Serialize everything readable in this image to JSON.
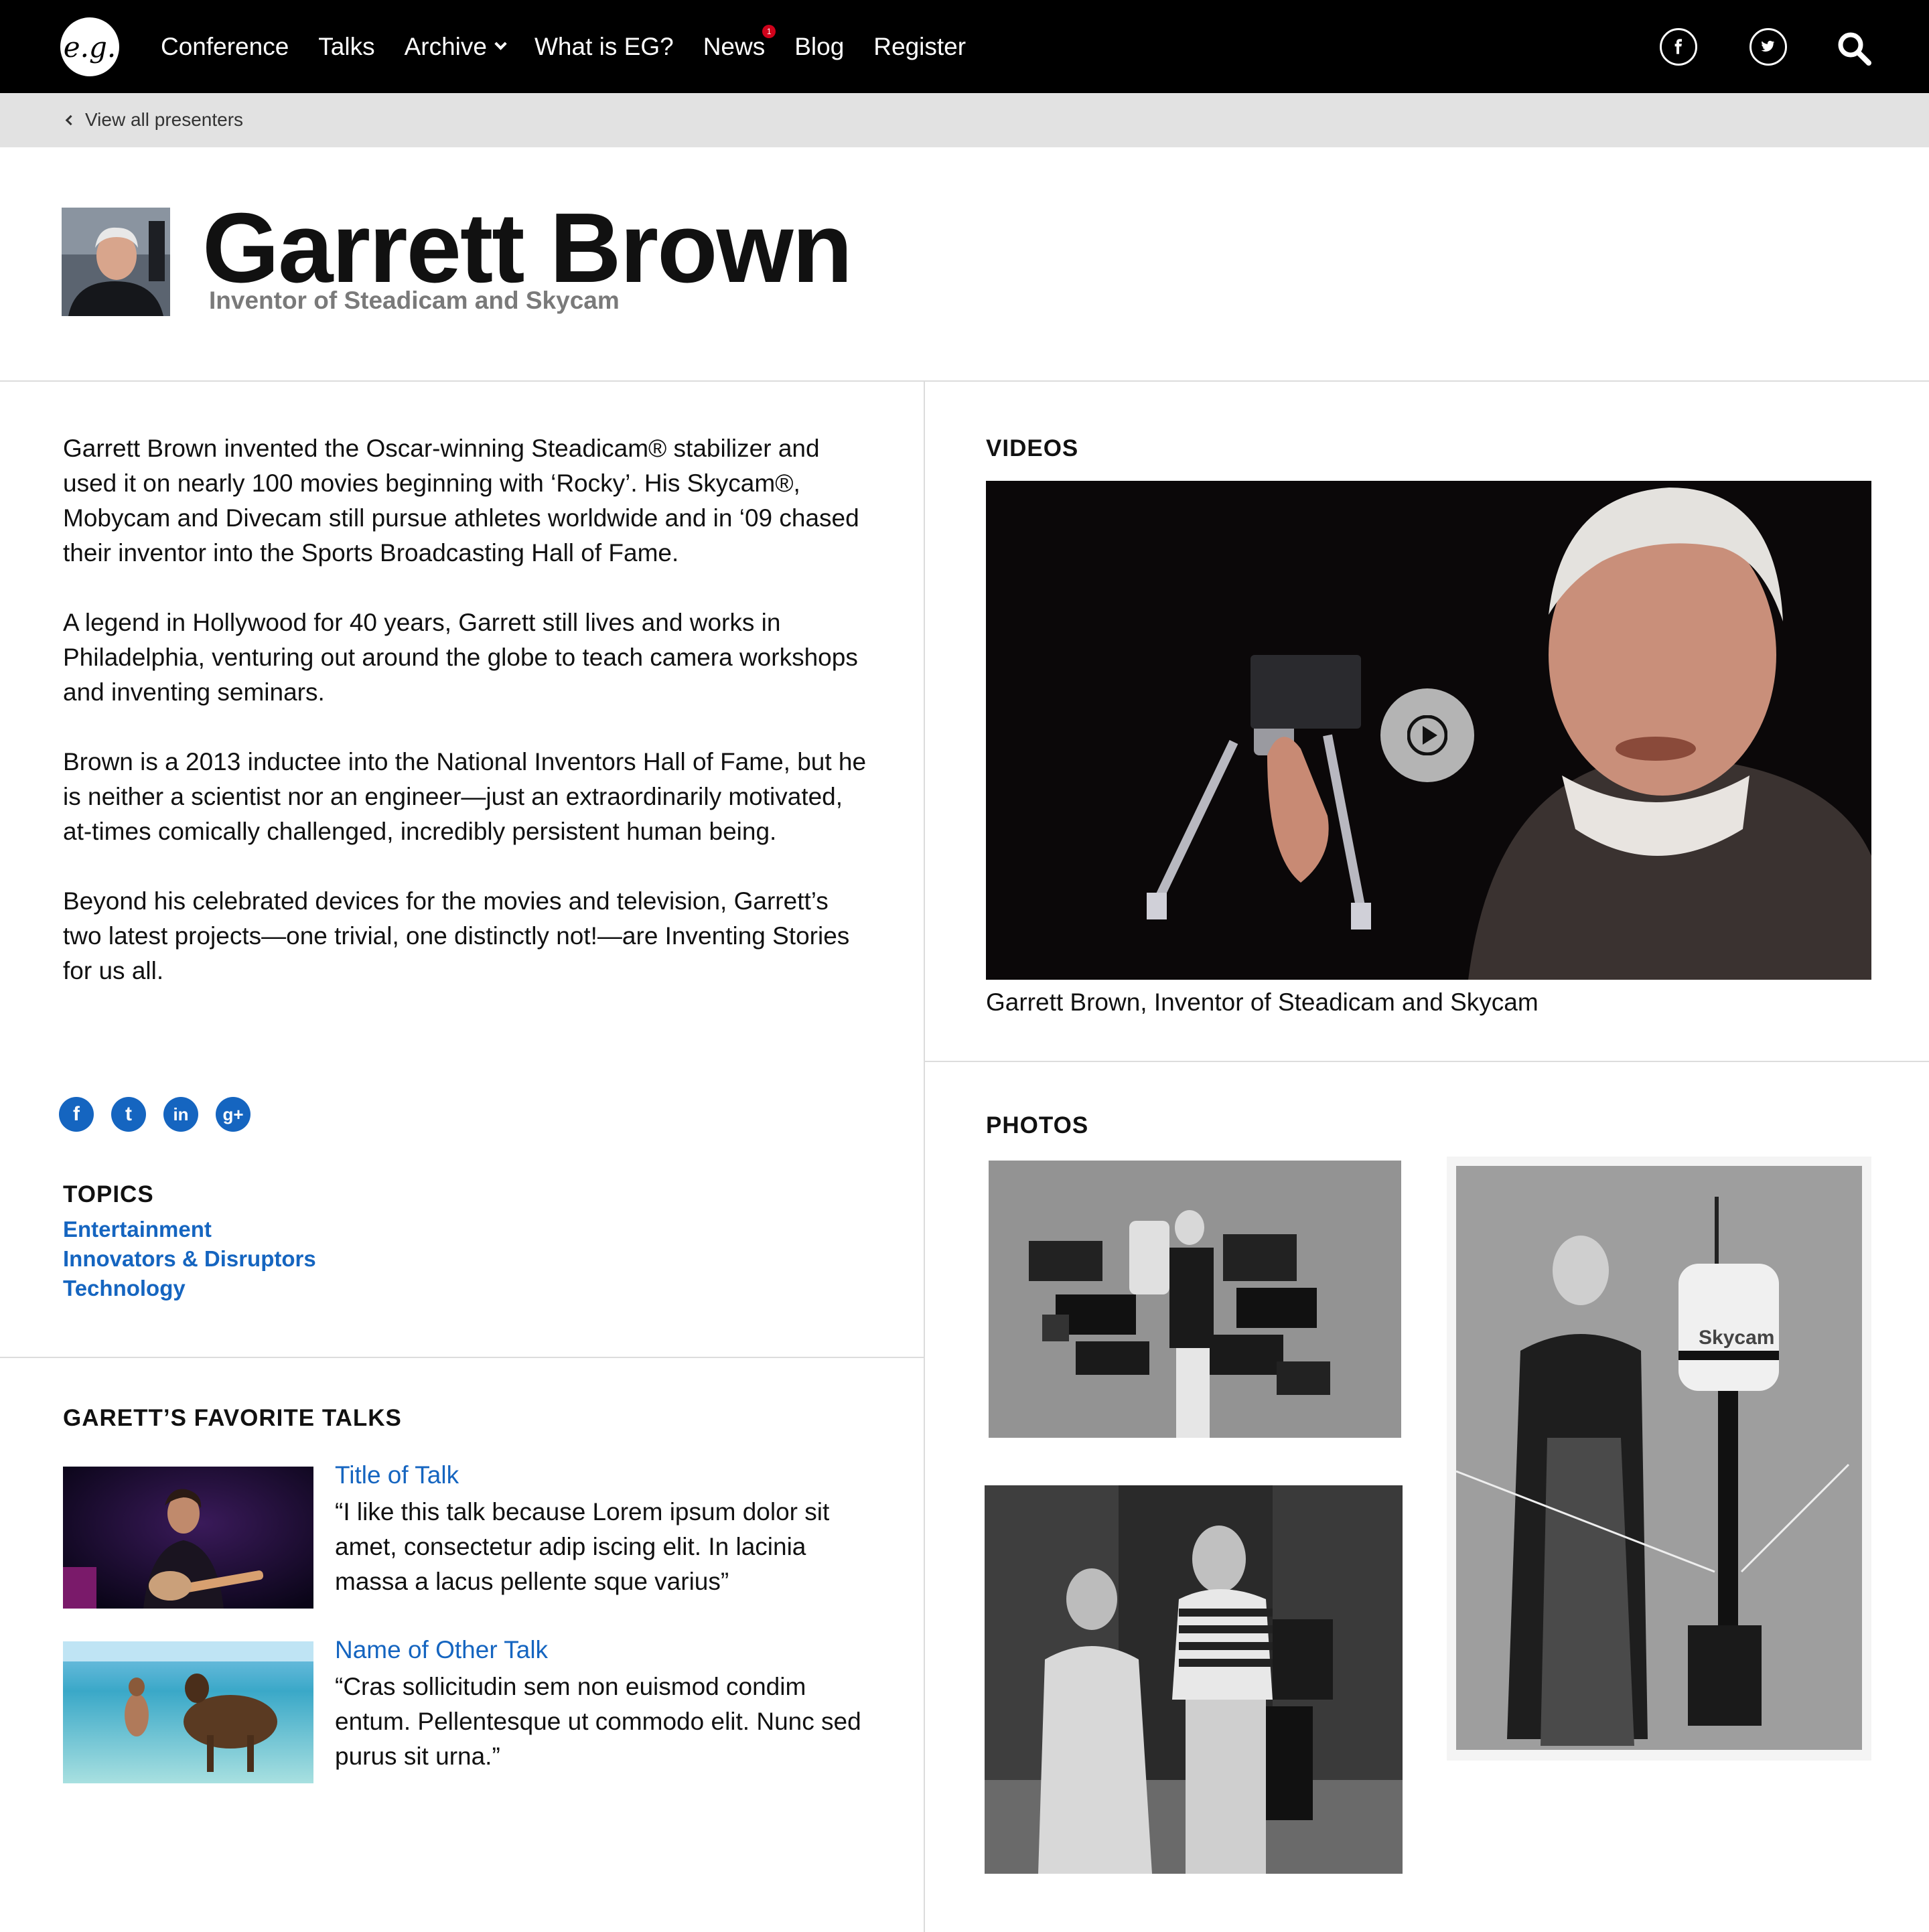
{
  "nav": {
    "logo_text": "e.g.",
    "links": [
      "Conference",
      "Talks",
      "Archive",
      "What is EG?",
      "News",
      "Blog",
      "Register"
    ],
    "news_badge": "1",
    "icons": [
      "facebook-icon",
      "twitter-icon",
      "search-icon"
    ]
  },
  "breadcrumb": {
    "label": "View all presenters"
  },
  "presenter": {
    "name": "Garrett Brown",
    "title": "Inventor of Steadicam and Skycam"
  },
  "bio": {
    "paragraphs": [
      "Garrett Brown invented the Oscar-winning  Steadicam® stabilizer and used it on nearly 100 movies beginning with ‘Rocky’.  His Skycam®, Mobycam and Divecam still pursue athletes worldwide and in ‘09 chased their inventor into the Sports Broadcasting Hall of Fame.",
      "A legend in Hollywood for 40 years, Garrett still lives and works in Philadelphia, venturing out around the globe to teach camera workshops and inventing seminars.",
      "Brown is a 2013 inductee into the National Inventors Hall of Fame, but he is neither a scientist nor an engineer—just an extraordinarily motivated, at-times comically challenged, incredibly persistent human being.",
      "Beyond his celebrated devices for the movies and television, Garrett’s two latest projects—one trivial, one distinctly not!—are Inventing Stories for us all."
    ]
  },
  "share": {
    "icons": [
      "facebook-share-icon",
      "twitter-share-icon",
      "linkedin-share-icon",
      "googleplus-share-icon"
    ],
    "glyphs": [
      "f",
      "t",
      "in",
      "g+"
    ],
    "color": "#1565c0"
  },
  "topics": {
    "heading": "TOPICS",
    "items": [
      "Entertainment",
      "Innovators & Disruptors",
      "Technology"
    ]
  },
  "favorites": {
    "heading": "GARETT’S FAVORITE TALKS",
    "talks": [
      {
        "title": "Title of Talk",
        "quote": "“I like this talk because Lorem ipsum dolor sit amet, consectetur adip iscing elit. In lacinia massa a lacus pellente sque varius”"
      },
      {
        "title": "Name of Other Talk",
        "quote": "“Cras sollicitudin sem non euismod condim entum. Pellentesque ut commodo elit. Nunc sed purus sit urna.”"
      }
    ]
  },
  "videos": {
    "heading": "VIDEOS",
    "caption": "Garrett Brown, Inventor of Steadicam and Skycam"
  },
  "photos": {
    "heading": "PHOTOS",
    "skycam_label": "Skycam"
  },
  "colors": {
    "nav_bg": "#000000",
    "crumb_bg": "#e2e2e2",
    "link": "#1565c0",
    "badge": "#d0021b",
    "subtitle": "#7a7a7a"
  }
}
